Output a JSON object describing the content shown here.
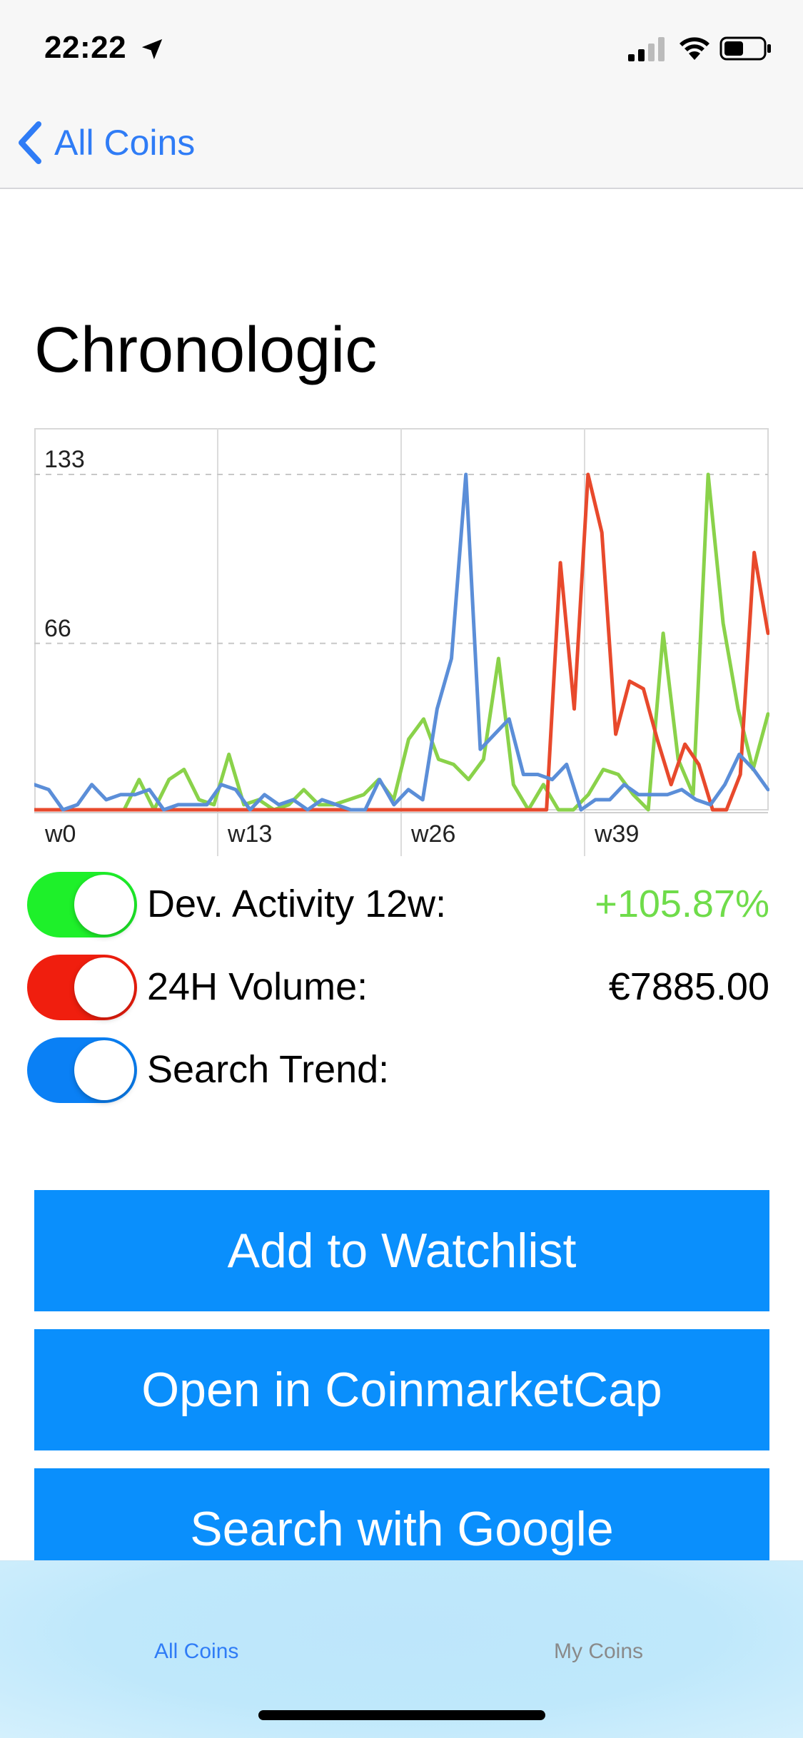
{
  "status": {
    "time": "22:22"
  },
  "nav": {
    "back_label": "All Coins"
  },
  "page": {
    "title": "Chronologic"
  },
  "chart_data": {
    "type": "line",
    "x_tick_labels": [
      "w0",
      "w13",
      "w26",
      "w39"
    ],
    "x_tick_weeks": [
      0,
      13,
      26,
      39
    ],
    "y_ticks": [
      133,
      66
    ],
    "ylim": [
      0,
      133
    ],
    "xlim": [
      0,
      52
    ],
    "grid": true,
    "series": [
      {
        "color": "#8ad24a",
        "values": [
          0,
          0,
          0,
          0,
          0,
          0,
          0,
          12,
          0,
          12,
          16,
          4,
          2,
          22,
          2,
          4,
          0,
          2,
          8,
          2,
          2,
          4,
          6,
          12,
          4,
          28,
          36,
          20,
          18,
          12,
          20,
          60,
          10,
          0,
          10,
          0,
          0,
          6,
          16,
          14,
          6,
          0,
          70,
          20,
          6,
          133,
          74,
          40,
          16,
          38
        ]
      },
      {
        "color": "#e8492c",
        "values": [
          0,
          0,
          0,
          0,
          0,
          0,
          0,
          0,
          0,
          0,
          0,
          0,
          0,
          0,
          0,
          0,
          0,
          0,
          0,
          0,
          0,
          0,
          0,
          0,
          0,
          0,
          0,
          0,
          0,
          0,
          0,
          0,
          0,
          0,
          0,
          0,
          0,
          0,
          98,
          40,
          133,
          110,
          30,
          51,
          48,
          28,
          10,
          26,
          18,
          0,
          0,
          14,
          102,
          70
        ]
      },
      {
        "color": "#5b8ed8",
        "values": [
          10,
          8,
          0,
          2,
          10,
          4,
          6,
          6,
          8,
          0,
          2,
          2,
          2,
          10,
          8,
          0,
          6,
          2,
          4,
          0,
          4,
          2,
          0,
          0,
          12,
          2,
          8,
          4,
          40,
          60,
          133,
          24,
          30,
          36,
          14,
          14,
          12,
          18,
          0,
          4,
          4,
          10,
          6,
          6,
          6,
          8,
          4,
          2,
          10,
          22,
          16,
          8
        ]
      }
    ]
  },
  "metrics": [
    {
      "label": "Dev. Activity 12w:",
      "value": "+105.87%",
      "value_color": "#6fdc4a",
      "toggle_color": "#1ef02a",
      "on": true
    },
    {
      "label": "24H Volume:",
      "value": "€7885.00",
      "value_color": "#000000",
      "toggle_color": "#f01e0e",
      "on": true
    },
    {
      "label": "Search Trend:",
      "value": "",
      "value_color": "#000000",
      "toggle_color": "#0a80f5",
      "on": true
    }
  ],
  "buttons": {
    "watchlist": "Add to Watchlist",
    "coinmarketcap": "Open in CoinmarketCap",
    "google": "Search with Google"
  },
  "tabs": [
    {
      "label": "All Coins",
      "active": true
    },
    {
      "label": "My Coins",
      "active": false
    }
  ],
  "colors": {
    "accent": "#2f7cf6",
    "button": "#0a8ffc"
  }
}
